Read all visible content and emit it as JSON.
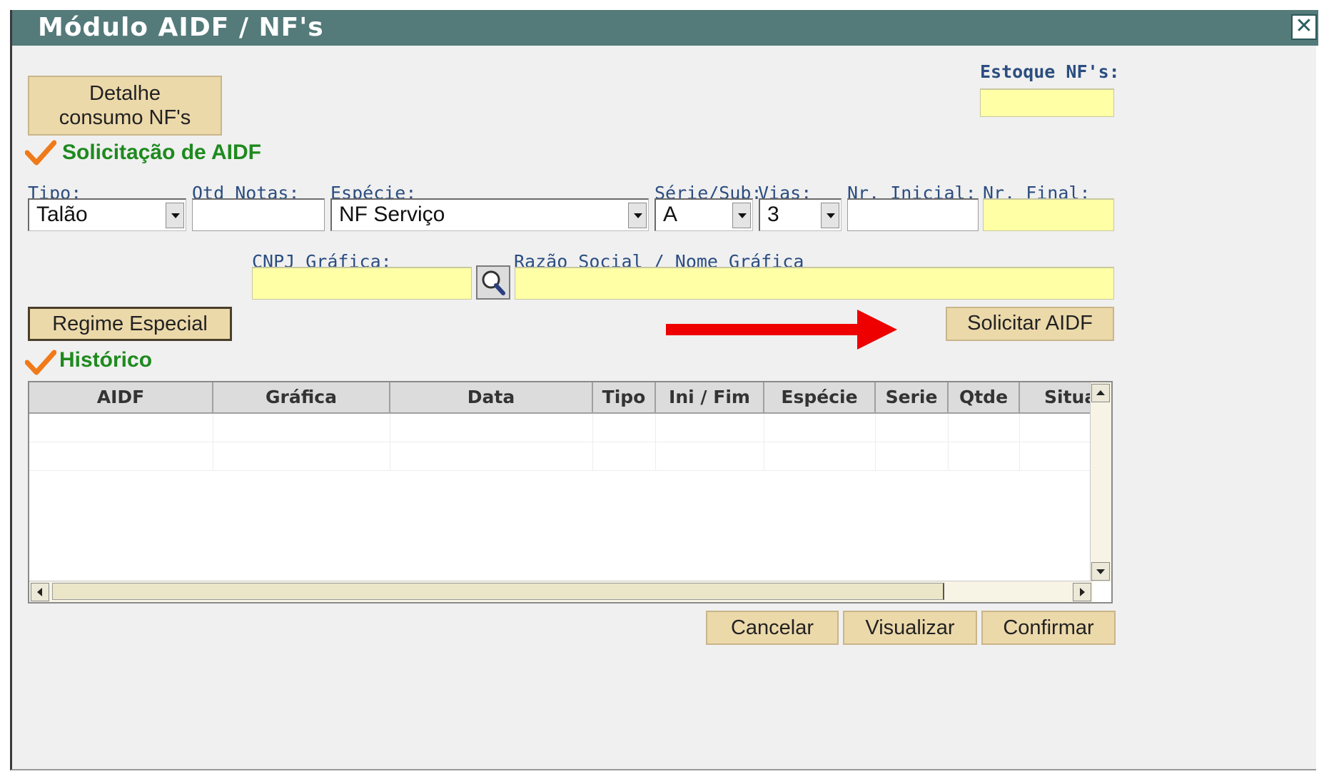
{
  "window": {
    "title": "Módulo AIDF / NF's",
    "close_glyph": "✕"
  },
  "stock": {
    "label": "Estoque NF's:",
    "value": ""
  },
  "buttons": {
    "detail_consumption": [
      "Detalhe",
      "consumo NF's"
    ],
    "special_regime": "Regime Especial",
    "request_aidf": "Solicitar AIDF",
    "cancel": "Cancelar",
    "view": "Visualizar",
    "confirm": "Confirmar"
  },
  "request_section": {
    "title": "Solicitação de AIDF",
    "fields": {
      "tipo": {
        "label": "Tipo:",
        "value": "Talão"
      },
      "qtd_notas": {
        "label": "Qtd Notas:",
        "value": ""
      },
      "especie": {
        "label": "Espécie:",
        "value": "NF Serviço"
      },
      "serie_sub": {
        "label": "Série/Sub:",
        "value": "A"
      },
      "vias": {
        "label": "Vias:",
        "value": "3"
      },
      "nr_inicial": {
        "label": "Nr. Inicial:",
        "value": ""
      },
      "nr_final": {
        "label": "Nr. Final:",
        "value": ""
      },
      "cnpj_grafica": {
        "label": "CNPJ Gráfica:",
        "value": ""
      },
      "razao_social": {
        "label": "Razão Social / Nome Gráfica",
        "value": ""
      }
    }
  },
  "history_section": {
    "title": "Histórico",
    "columns": [
      "AIDF",
      "Gráfica",
      "Data",
      "Tipo",
      "Ini / Fim",
      "Espécie",
      "Serie",
      "Qtde",
      "Situa"
    ],
    "rows": []
  },
  "icons": {
    "check": "check-icon",
    "search": "magnifier-icon",
    "annotation": "red-arrow"
  },
  "colors": {
    "titlebar": "#547a7a",
    "button": "#ecd9aa",
    "highlight_field": "#ffffa6",
    "section_title": "#1e8a1e",
    "label": "#2b4d80",
    "check": "#f07a1a",
    "annotation_arrow": "#ee0000"
  }
}
